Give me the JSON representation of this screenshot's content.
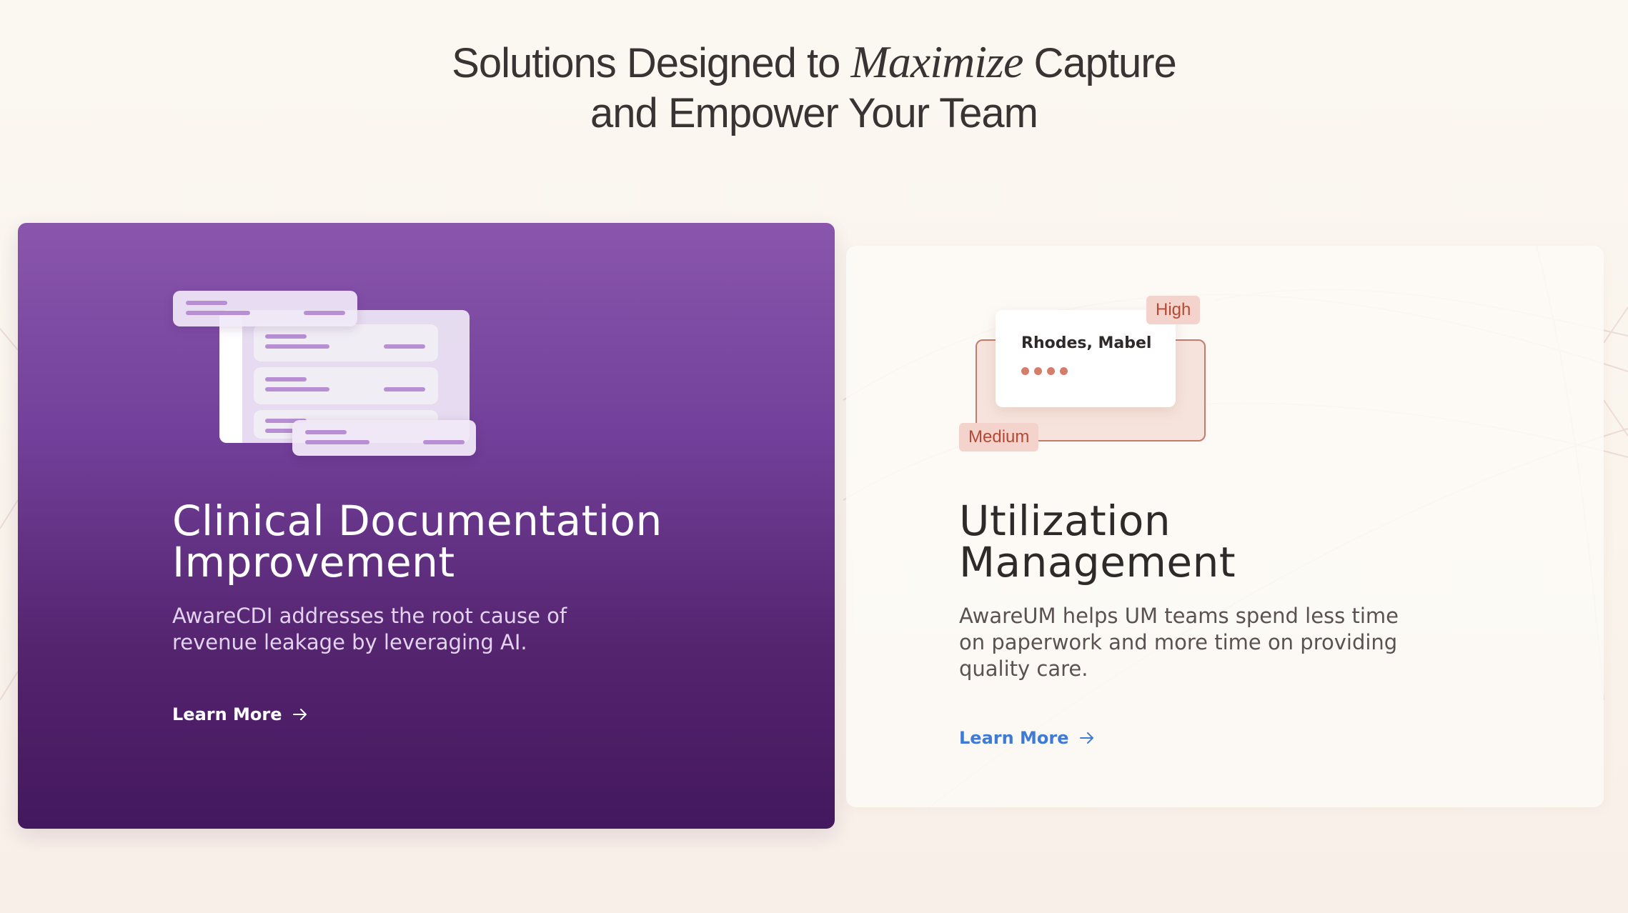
{
  "headline": {
    "line1_pre": "Solutions Designed to ",
    "line1_em": "Maximize",
    "line1_post": " Capture",
    "line2": "and Empower Your Team"
  },
  "cards": [
    {
      "title_line1": "Clinical Documentation",
      "title_line2": "Improvement",
      "desc_line1": "AwareCDI addresses the root cause of",
      "desc_line2": "revenue leakage by leveraging AI.",
      "cta": "Learn More",
      "colors": {
        "bg_top": "#8a56ad",
        "bg_bottom": "#43185e",
        "text": "#ffffff"
      }
    },
    {
      "title_line1": "Utilization",
      "title_line2": "Management",
      "desc_line1": "AwareUM helps UM teams spend less time",
      "desc_line2": "on paperwork and more time on providing",
      "desc_line3": "quality care.",
      "cta": "Learn More",
      "illustration": {
        "patient_name": "Rhodes, Mabel",
        "badge_high": "High",
        "badge_medium": "Medium"
      },
      "colors": {
        "title": "#2f2a2a",
        "cta": "#3f7ad6",
        "badge": "#b44a36"
      }
    }
  ],
  "icons": [
    "arrow-right-icon",
    "document-stack-icon"
  ]
}
